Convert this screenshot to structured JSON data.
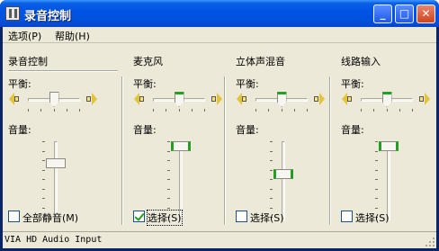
{
  "window": {
    "title": "录音控制",
    "buttons": {
      "minimize": "_",
      "maximize": "□",
      "close": "✕"
    }
  },
  "menu": {
    "items": [
      "选项(P)",
      "帮助(H)"
    ]
  },
  "sections": [
    {
      "title": "录音控制",
      "balance_label": "平衡:",
      "balance": 0.5,
      "volume_label": "音量:",
      "volume": 0.75,
      "checkbox_label": "全部静音(M)",
      "checked": false,
      "focused": false,
      "active": false
    },
    {
      "title": "麦克风",
      "balance_label": "平衡:",
      "balance": 0.5,
      "volume_label": "音量:",
      "volume": 1.0,
      "checkbox_label": "选择(S)",
      "checked": true,
      "focused": true,
      "active": true
    },
    {
      "title": "立体声混音",
      "balance_label": "平衡:",
      "balance": 0.5,
      "volume_label": "音量:",
      "volume": 0.6,
      "checkbox_label": "选择(S)",
      "checked": false,
      "focused": false,
      "active": true
    },
    {
      "title": "线路输入",
      "balance_label": "平衡:",
      "balance": 0.5,
      "volume_label": "音量:",
      "volume": 1.0,
      "checkbox_label": "选择(S)",
      "checked": false,
      "focused": false,
      "active": true
    }
  ],
  "status": {
    "text": "VIA HD Audio Input"
  },
  "colors": {
    "titlebar": "#0054e3",
    "face": "#ece9d8",
    "thumb_accent": "#21a121"
  }
}
